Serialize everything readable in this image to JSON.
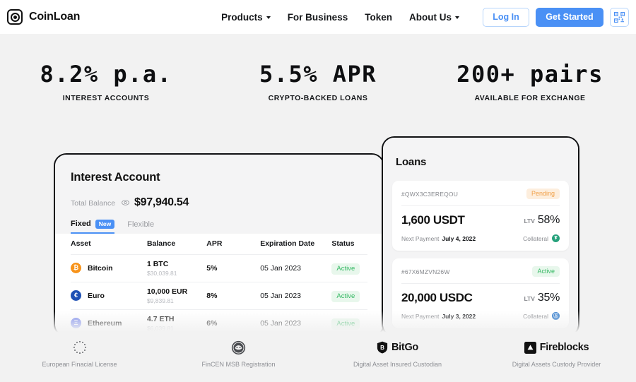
{
  "header": {
    "brand": "CoinLoan",
    "nav": [
      {
        "label": "Products",
        "has_caret": true
      },
      {
        "label": "For Business",
        "has_caret": false
      },
      {
        "label": "Token",
        "has_caret": false
      },
      {
        "label": "About Us",
        "has_caret": true
      }
    ],
    "login_label": "Log In",
    "get_started_label": "Get Started",
    "qr_icon": "qr-code-download-icon",
    "accent_color": "#4a90f5"
  },
  "stats": [
    {
      "value": "8.2% p.a.",
      "label": "INTEREST ACCOUNTS"
    },
    {
      "value": "5.5% APR",
      "label": "CRYPTO-BACKED LOANS"
    },
    {
      "value": "200+ pairs",
      "label": "AVAILABLE FOR EXCHANGE"
    }
  ],
  "interest_account": {
    "title": "Interest Account",
    "balance_label": "Total Balance",
    "balance_value": "$97,940.54",
    "tabs": [
      {
        "label": "Fixed",
        "badge": "New",
        "active": true
      },
      {
        "label": "Flexible",
        "badge": null,
        "active": false
      }
    ],
    "columns": [
      "Asset",
      "Balance",
      "APR",
      "Expiration Date",
      "Status"
    ],
    "rows": [
      {
        "asset": "Bitcoin",
        "symbol": "₿",
        "color": "#f7931a",
        "balance": "1 BTC",
        "balance_fiat": "$30,039.81",
        "apr": "5%",
        "expiration": "05 Jan 2023",
        "status": "Active"
      },
      {
        "asset": "Euro",
        "symbol": "€",
        "color": "#1e50b4",
        "balance": "10,000 EUR",
        "balance_fiat": "$9,839.81",
        "apr": "8%",
        "expiration": "05 Jan 2023",
        "status": "Active"
      },
      {
        "asset": "Ethereum",
        "symbol": "Ξ",
        "color": "#7b8bee",
        "balance": "4.7 ETH",
        "balance_fiat": "$6,039.81",
        "apr": "6%",
        "expiration": "05 Jan 2023",
        "status": "Active"
      }
    ]
  },
  "loans": {
    "title": "Loans",
    "items": [
      {
        "id": "#QWX3C3EREQOU",
        "status": "Pending",
        "status_type": "pending",
        "amount": "1,600 USDT",
        "ltv_label": "LTV",
        "ltv_value": "58%",
        "next_payment_label": "Next Payment",
        "next_payment_date": "July 4, 2022",
        "collateral_label": "Collateral",
        "collateral_symbol": "₮",
        "collateral_color": "#26a17b"
      },
      {
        "id": "#67X6MZVN26W",
        "status": "Active",
        "status_type": "active",
        "amount": "20,000 USDC",
        "ltv_label": "LTV",
        "ltv_value": "35%",
        "next_payment_label": "Next Payment",
        "next_payment_date": "July 3, 2022",
        "collateral_label": "Collateral",
        "collateral_symbol": "Ⓢ",
        "collateral_color": "#2775ca"
      }
    ]
  },
  "footer": [
    {
      "icon": "eu-stars-icon",
      "logo_text": "",
      "label": "European Finacial License"
    },
    {
      "icon": "fincen-seal-icon",
      "logo_text": "",
      "label": "FinCEN MSB Registration"
    },
    {
      "icon": "bitgo-shield-icon",
      "logo_text": "BitGo",
      "label": "Digital Asset Insured Custodian"
    },
    {
      "icon": "fireblocks-icon",
      "logo_text": "Fireblocks",
      "label": "Digital Assets Custody Provider"
    }
  ]
}
